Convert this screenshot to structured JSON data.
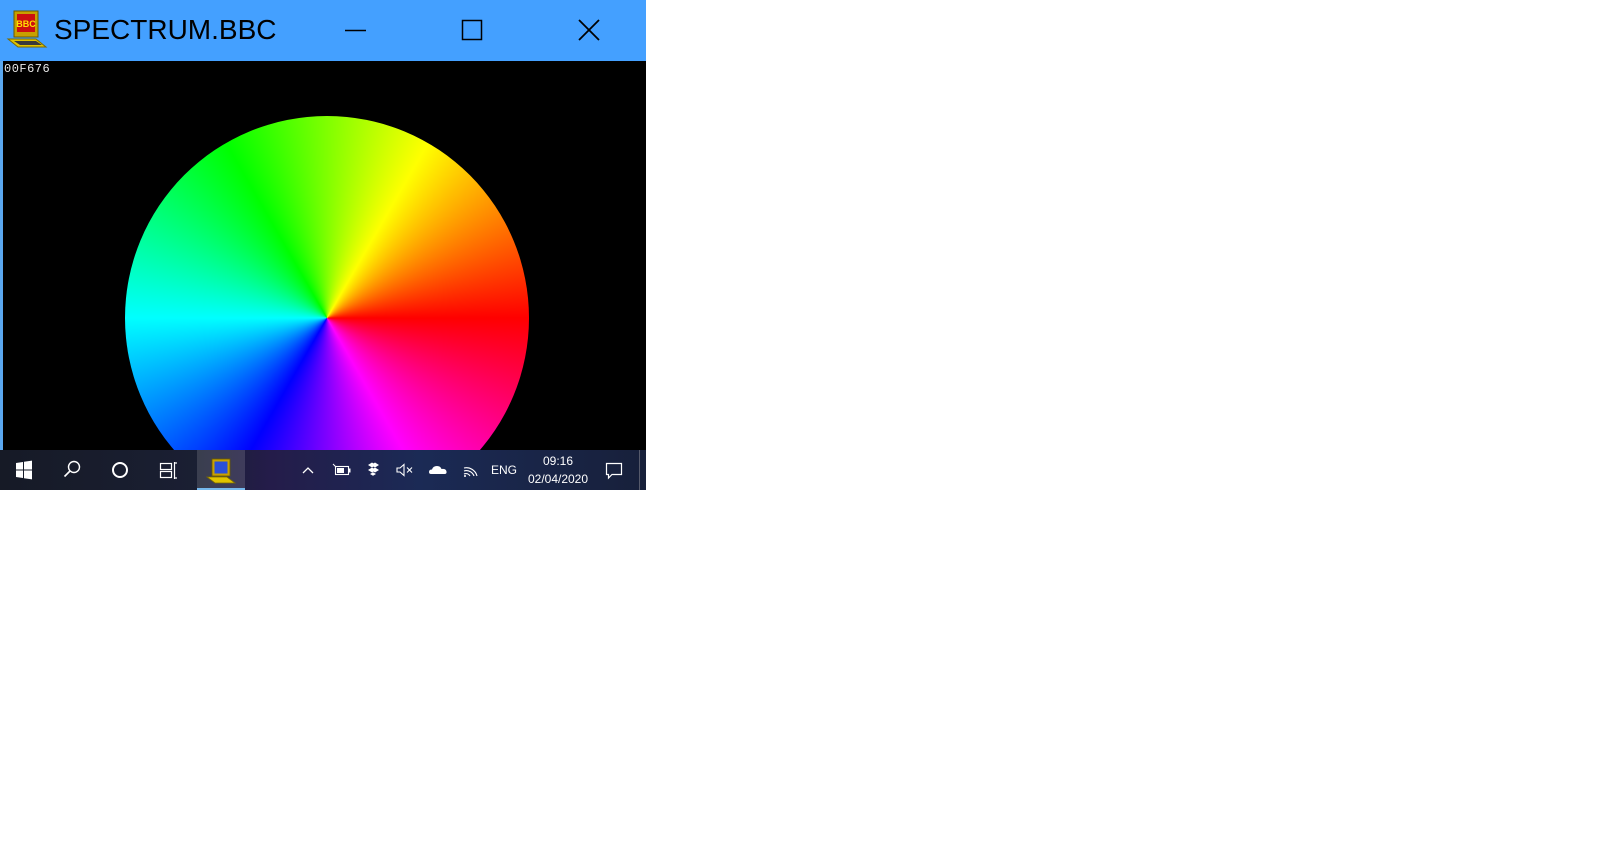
{
  "window": {
    "title": "SPECTRUM.BBC",
    "icon": "bbc-micro-icon",
    "icon_text": "BBC",
    "titlebar_color": "#44a0ff"
  },
  "controls": {
    "minimize": "minimize-icon",
    "maximize": "maximize-icon",
    "close": "close-icon"
  },
  "canvas": {
    "readout": "00F676",
    "wheel_colors": [
      "#ff0000",
      "#ff00ff",
      "#0000ff",
      "#00ffff",
      "#00ff00",
      "#ffff00"
    ]
  },
  "taskbar": {
    "start": "windows-icon",
    "search": "search-icon",
    "cortana": "cortana-icon",
    "task_view": "task-view-icon",
    "pinned_app": "bbc-micro-icon",
    "tray": [
      "chevron-up-icon",
      "battery-icon",
      "dropbox-icon",
      "volume-muted-icon",
      "onedrive-icon",
      "wifi-icon"
    ],
    "language": "ENG",
    "time": "09:16",
    "date": "02/04/2020",
    "notifications": "action-center-icon"
  }
}
